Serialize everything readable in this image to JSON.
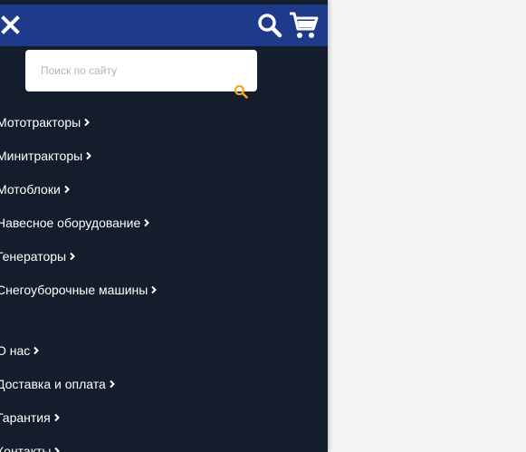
{
  "header": {
    "close_icon": "close-icon",
    "search_icon": "search-icon",
    "cart_icon": "cart-icon",
    "colors": {
      "bar": "#1e3a8a",
      "drawer": "#141d2b",
      "accent": "#f5a623"
    }
  },
  "search": {
    "placeholder": "Поиск по сайту",
    "value": "",
    "submit_icon": "search-icon"
  },
  "menu": {
    "catalog": [
      {
        "label": "Мототракторы"
      },
      {
        "label": "Минитракторы"
      },
      {
        "label": "Мотоблоки"
      },
      {
        "label": "Навесное оборудование"
      },
      {
        "label": "Генераторы"
      },
      {
        "label": "Снегоуборочные машины"
      }
    ],
    "info": [
      {
        "label": "О нас"
      },
      {
        "label": "Доставка и оплата"
      },
      {
        "label": "Гарантия"
      },
      {
        "label": "Контакты"
      }
    ],
    "chevron_icon": "chevron-right-icon"
  }
}
